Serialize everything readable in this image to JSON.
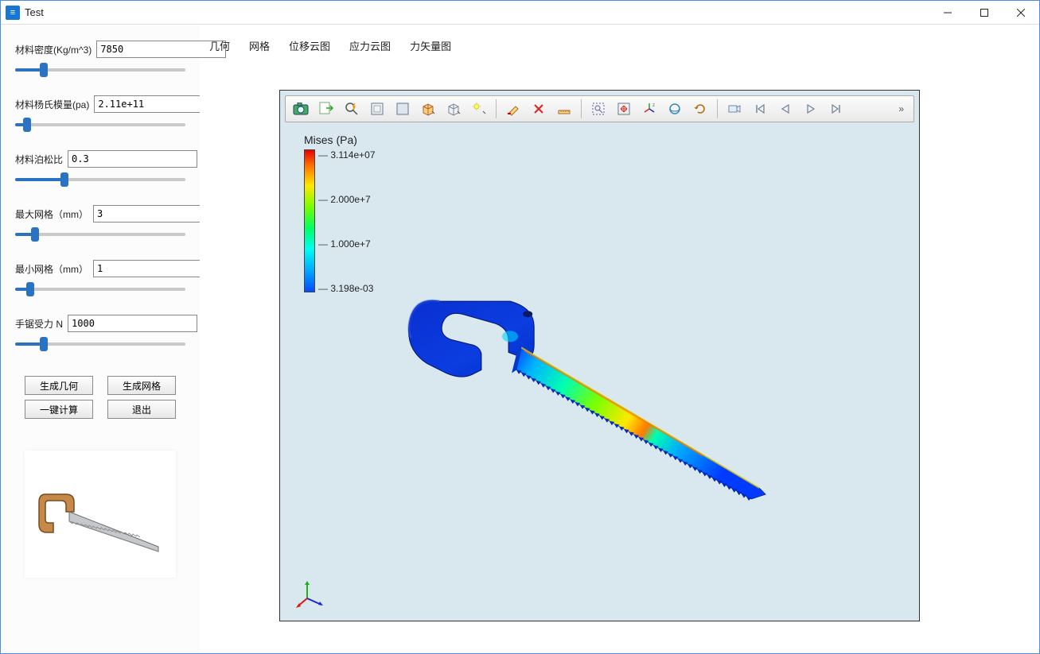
{
  "window": {
    "title": "Test"
  },
  "sidebar": {
    "params": [
      {
        "label": "材料密度(Kg/m^3)",
        "value": "7850",
        "slider_pct": 15
      },
      {
        "label": "材料杨氏模量(pa)",
        "value": "2.11e+11",
        "slider_pct": 5
      },
      {
        "label": "材料泊松比",
        "value": "0.3",
        "slider_pct": 28
      },
      {
        "label": "最大网格（mm）",
        "value": "3",
        "slider_pct": 10
      },
      {
        "label": "最小网格（mm）",
        "value": "1",
        "slider_pct": 7
      },
      {
        "label": "手锯受力 N",
        "value": "1000",
        "slider_pct": 15
      }
    ],
    "buttons": {
      "gen_geom": "生成几何",
      "gen_mesh": "生成网格",
      "one_click": "一键计算",
      "exit": "退出"
    }
  },
  "tabs": {
    "items": [
      "几何",
      "网格",
      "位移云图",
      "应力云图",
      "力矢量图"
    ],
    "active_index": 3
  },
  "toolbar": {
    "more": "»"
  },
  "legend": {
    "title": "Mises (Pa)",
    "ticks": [
      "3.114e+07",
      "2.000e+7",
      "1.000e+7",
      "3.198e-03"
    ]
  },
  "chart_data": {
    "type": "heatmap",
    "title": "Mises (Pa)",
    "colorbar_label": "Mises (Pa)",
    "colorbar_ticks": [
      0.003198,
      10000000.0,
      20000000.0,
      31140000.0
    ],
    "colorbar_range": [
      0.003198,
      31140000.0
    ],
    "unit": "Pa",
    "description": "Von Mises stress contour on hand-saw model; highest stress (~3.1e7 Pa) appears along the blade near the handle joint, lowest (~0) on the C-shaped handle."
  }
}
